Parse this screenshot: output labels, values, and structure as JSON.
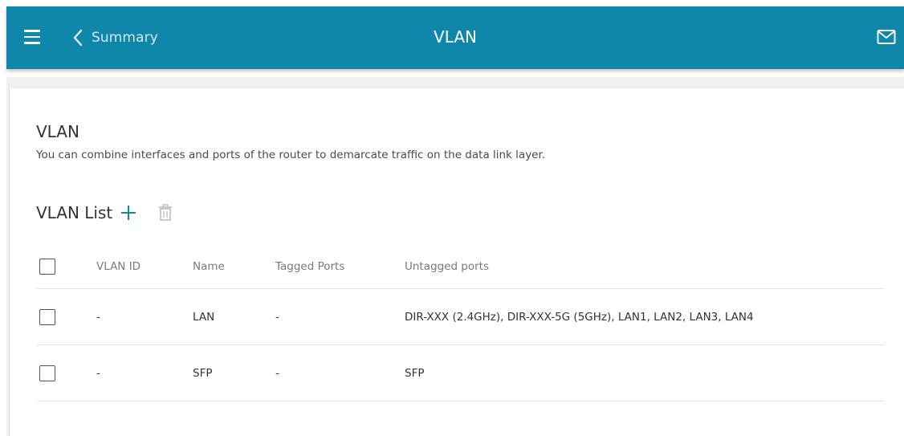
{
  "header": {
    "back_label": "Summary",
    "title": "VLAN",
    "menu_icon": "hamburger-menu-icon",
    "back_icon": "chevron-left-icon",
    "mail_icon": "mail-icon",
    "bar_color": "#0e87ab"
  },
  "section": {
    "title": "VLAN",
    "description": "You can combine interfaces and ports of the router to demarcate traffic on the data link layer."
  },
  "vlan_list": {
    "title": "VLAN List",
    "add_icon": "plus-icon",
    "delete_icon": "trash-icon",
    "accent_color": "#0e87ab",
    "columns": {
      "vlan_id": "VLAN ID",
      "name": "Name",
      "tagged_ports": "Tagged Ports",
      "untagged_ports": "Untagged ports"
    },
    "rows": [
      {
        "vlan_id": "-",
        "name": "LAN",
        "tagged_ports": "-",
        "untagged_ports": "DIR-XXX (2.4GHz), DIR-XXX-5G (5GHz), LAN1, LAN2, LAN3, LAN4"
      },
      {
        "vlan_id": "-",
        "name": "SFP",
        "tagged_ports": "-",
        "untagged_ports": "SFP"
      }
    ]
  }
}
